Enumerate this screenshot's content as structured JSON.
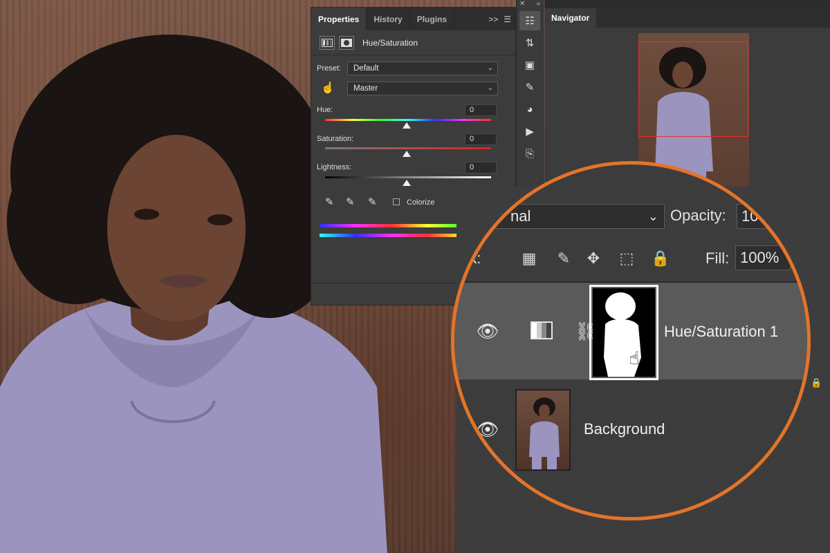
{
  "properties": {
    "tabs": [
      {
        "label": "Properties",
        "active": true
      },
      {
        "label": "History",
        "active": false
      },
      {
        "label": "Plugins",
        "active": false
      }
    ],
    "tab_menu": ">>",
    "adjustment_name": "Hue/Saturation",
    "preset_label": "Preset:",
    "preset_value": "Default",
    "channel_value": "Master",
    "hue_label": "Hue:",
    "hue_value": "0",
    "saturation_label": "Saturation:",
    "saturation_value": "0",
    "lightness_label": "Lightness:",
    "lightness_value": "0",
    "colorize_label": "Colorize",
    "colorize_checked": false
  },
  "navigator": {
    "tab_label": "Navigator"
  },
  "layers": {
    "blend_mode_partial": "nal",
    "opacity_label": "Opacity:",
    "opacity_value_partial": "10",
    "lock_label_partial": "ock:",
    "fill_label": "Fill:",
    "fill_value": "100%",
    "items": [
      {
        "name": "Hue/Saturation 1",
        "selected": true,
        "visible": true
      },
      {
        "name": "Background",
        "selected": false,
        "visible": true,
        "locked": true
      }
    ]
  },
  "colors": {
    "accent_ring": "#e3742a",
    "panel_bg": "#3c3c3c",
    "selected_layer": "#5a5a5a",
    "nav_view_box": "#e03030"
  }
}
